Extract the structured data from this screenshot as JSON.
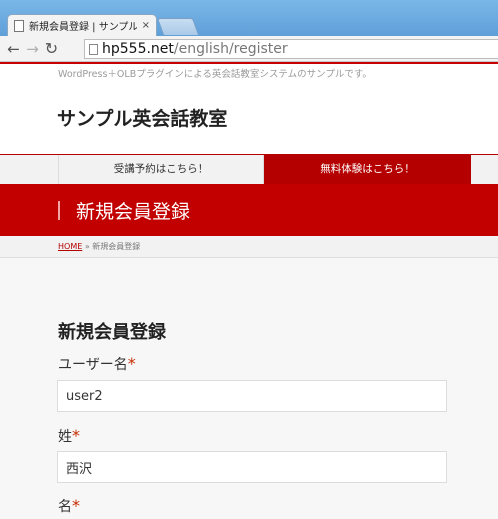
{
  "browser": {
    "tab_title": "新規会員登録 | サンプル英",
    "tab_close": "×",
    "url_host": "hp555.net",
    "url_path": "/english/register"
  },
  "site": {
    "tagline": "WordPress＋OLBプラグインによる英会話教室システムのサンプルです。",
    "title": "サンプル英会話教室"
  },
  "nav": {
    "items": [
      {
        "label": "受講予約はこちら！"
      },
      {
        "label": "無料体験はこちら！"
      }
    ]
  },
  "banner": {
    "title": "新規会員登録"
  },
  "breadcrumb": {
    "home": "HOME",
    "separator": "»",
    "current": "新規会員登録"
  },
  "form": {
    "title": "新規会員登録",
    "required_mark": "*",
    "username": {
      "label": "ユーザー名",
      "value": "user2"
    },
    "last_name": {
      "label": "姓",
      "value": "西沢"
    },
    "first_name": {
      "label": "名"
    }
  },
  "colors": {
    "accent": "#c20000",
    "accent_dark": "#b50000",
    "required": "#c42c00"
  }
}
